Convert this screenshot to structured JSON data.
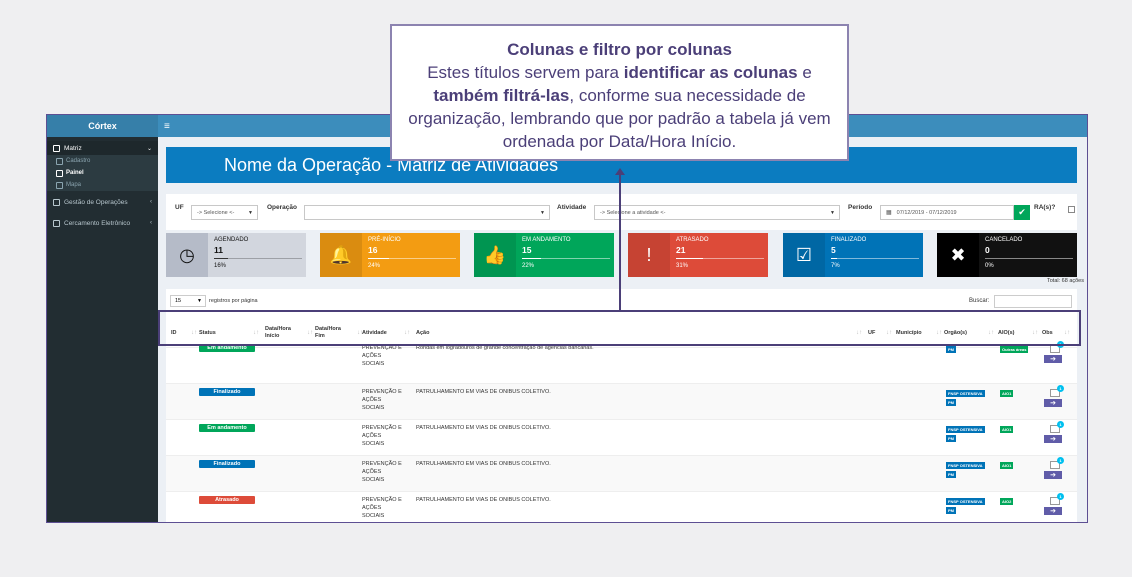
{
  "callout": {
    "title": "Colunas e filtro por colunas",
    "line_pre": "Estes títulos servem para ",
    "bold1": "identificar as colunas",
    "mid1": " e ",
    "bold2": "também filtrá-las",
    "line_post": ", conforme sua necessidade de organização, lembrando que por padrão a tabela já vem ordenada por Data/Hora Início."
  },
  "sidebar": {
    "brand": "Córtex",
    "items": [
      {
        "label": "Matriz",
        "icon": "book-icon"
      },
      {
        "label": "Cadastro",
        "icon": "edit-icon"
      },
      {
        "label": "Painel",
        "icon": "dashboard-icon"
      },
      {
        "label": "Mapa",
        "icon": "map-icon"
      },
      {
        "label": "Gestão de Operações",
        "icon": "group-icon"
      },
      {
        "label": "Cercamento Eletrônico",
        "icon": "car-icon"
      }
    ]
  },
  "topbar": {
    "menu_icon": "≡"
  },
  "banner": {
    "title": "Nome da Operação - Matriz de Atividades"
  },
  "filters": {
    "uf_label": "UF",
    "uf_value": "-> Selecione <-",
    "operacao_label": "Operação",
    "atividade_label": "Atividade",
    "atividade_value": "-> Selecione a atividade <-",
    "periodo_label": "Período",
    "periodo_value": "07/12/2019 - 07/12/2019",
    "ra_label": "RA(s)?"
  },
  "cards": [
    {
      "title": "AGENDADO",
      "count": "11",
      "pct": "16%",
      "fill": 0.16,
      "color": "#d2d6de",
      "icon_color": "#b5bbc8",
      "icon": "clock-icon",
      "glyph": "◷"
    },
    {
      "title": "PRÉ-INÍCIO",
      "count": "16",
      "pct": "24%",
      "fill": 0.24,
      "color": "#f39c12",
      "icon_color": "#da8c10",
      "icon": "bell-icon",
      "glyph": "🔔"
    },
    {
      "title": "EM ANDAMENTO",
      "count": "15",
      "pct": "22%",
      "fill": 0.22,
      "color": "#00a65a",
      "icon_color": "#009551",
      "icon": "thumbs-up-icon",
      "glyph": "👍"
    },
    {
      "title": "ATRASADO",
      "count": "21",
      "pct": "31%",
      "fill": 0.31,
      "color": "#dd4b39",
      "icon_color": "#c64333",
      "icon": "exclamation-icon",
      "glyph": "!"
    },
    {
      "title": "FINALIZADO",
      "count": "5",
      "pct": "7%",
      "fill": 0.07,
      "color": "#0073b7",
      "icon_color": "#0067a4",
      "icon": "check-square-icon",
      "glyph": "☑"
    },
    {
      "title": "CANCELADO",
      "count": "0",
      "pct": "0%",
      "fill": 0,
      "color": "#111111",
      "icon_color": "#000000",
      "icon": "x-icon",
      "glyph": "✖"
    }
  ],
  "total": "Total: 68 ações",
  "table": {
    "length_value": "15",
    "length_label": "registros por página",
    "search_label": "Buscar:",
    "columns": [
      "ID",
      "Status",
      "Data/Hora Início",
      "Data/Hora Fim",
      "Atividade",
      "Ação",
      "UF",
      "Município",
      "Orgão(s)",
      "AIO(s)",
      "Obs"
    ],
    "rows": [
      {
        "status": "Em andamento",
        "status_color": "green",
        "atividade": [
          "PREVENÇÃO E",
          "AÇÕES",
          "SOCIAIS"
        ],
        "acao": "Rondas em logradouros de grande concentração de agências bancárias.",
        "orgaos": [
          "PM"
        ],
        "aios": [
          "Outras áreas"
        ]
      },
      {
        "status": "Finalizado",
        "status_color": "blue",
        "atividade": [
          "PREVENÇÃO E",
          "AÇÕES",
          "SOCIAIS"
        ],
        "acao": "PATRULHAMENTO EM VIAS DE ONIBUS COLETIVO.",
        "orgaos": [
          "FNSP OSTENSIVA",
          "PM"
        ],
        "aios": [
          "AIO1"
        ]
      },
      {
        "status": "Em andamento",
        "status_color": "green",
        "atividade": [
          "PREVENÇÃO E",
          "AÇÕES",
          "SOCIAIS"
        ],
        "acao": "PATRULHAMENTO EM VIAS DE ONIBUS COLETIVO.",
        "orgaos": [
          "FNSP OSTENSIVA",
          "PM"
        ],
        "aios": [
          "AIO1"
        ]
      },
      {
        "status": "Finalizado",
        "status_color": "blue",
        "atividade": [
          "PREVENÇÃO E",
          "AÇÕES",
          "SOCIAIS"
        ],
        "acao": "PATRULHAMENTO EM VIAS DE ONIBUS COLETIVO.",
        "orgaos": [
          "FNSP OSTENSIVA",
          "PM"
        ],
        "aios": [
          "AIO1"
        ]
      },
      {
        "status": "Atrasado",
        "status_color": "red",
        "atividade": [
          "PREVENÇÃO E",
          "AÇÕES",
          "SOCIAIS"
        ],
        "acao": "PATRULHAMENTO EM VIAS DE ONIBUS COLETIVO.",
        "orgaos": [
          "FNSP OSTENSIVA",
          "PM"
        ],
        "aios": [
          "AIO2"
        ]
      }
    ]
  }
}
